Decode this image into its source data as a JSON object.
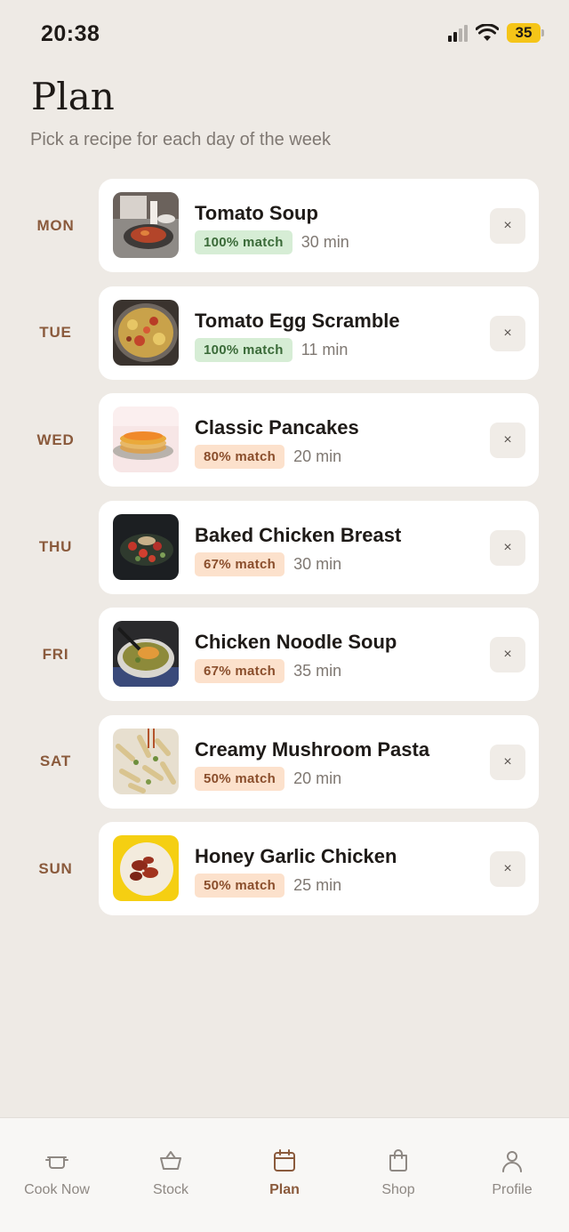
{
  "status_bar": {
    "time": "20:38",
    "battery": "35"
  },
  "header": {
    "title": "Plan",
    "subtitle": "Pick a recipe for each day of the week"
  },
  "plan": [
    {
      "day": "MON",
      "recipe": "Tomato Soup",
      "match": "100% match",
      "match_level": "high",
      "time": "30 min",
      "remove": "×"
    },
    {
      "day": "TUE",
      "recipe": "Tomato Egg Scramble",
      "match": "100% match",
      "match_level": "high",
      "time": "11 min",
      "remove": "×"
    },
    {
      "day": "WED",
      "recipe": "Classic Pancakes",
      "match": "80% match",
      "match_level": "mid",
      "time": "20 min",
      "remove": "×"
    },
    {
      "day": "THU",
      "recipe": "Baked Chicken Breast",
      "match": "67% match",
      "match_level": "mid",
      "time": "30 min",
      "remove": "×"
    },
    {
      "day": "FRI",
      "recipe": "Chicken Noodle Soup",
      "match": "67% match",
      "match_level": "mid",
      "time": "35 min",
      "remove": "×"
    },
    {
      "day": "SAT",
      "recipe": "Creamy Mushroom Pasta",
      "match": "50% match",
      "match_level": "mid",
      "time": "20 min",
      "remove": "×"
    },
    {
      "day": "SUN",
      "recipe": "Honey Garlic Chicken",
      "match": "50% match",
      "match_level": "mid",
      "time": "25 min",
      "remove": "×"
    }
  ],
  "nav": {
    "items": [
      {
        "label": "Cook Now",
        "icon": "pot-icon"
      },
      {
        "label": "Stock",
        "icon": "basket-icon"
      },
      {
        "label": "Plan",
        "icon": "calendar-icon",
        "active": true
      },
      {
        "label": "Shop",
        "icon": "shopping-bag-icon"
      },
      {
        "label": "Profile",
        "icon": "person-icon"
      }
    ]
  },
  "colors": {
    "background": "#EEEAE5",
    "accent": "#8A5A3C",
    "high_match_bg": "#D6EDD5",
    "mid_match_bg": "#FCE1CC"
  }
}
